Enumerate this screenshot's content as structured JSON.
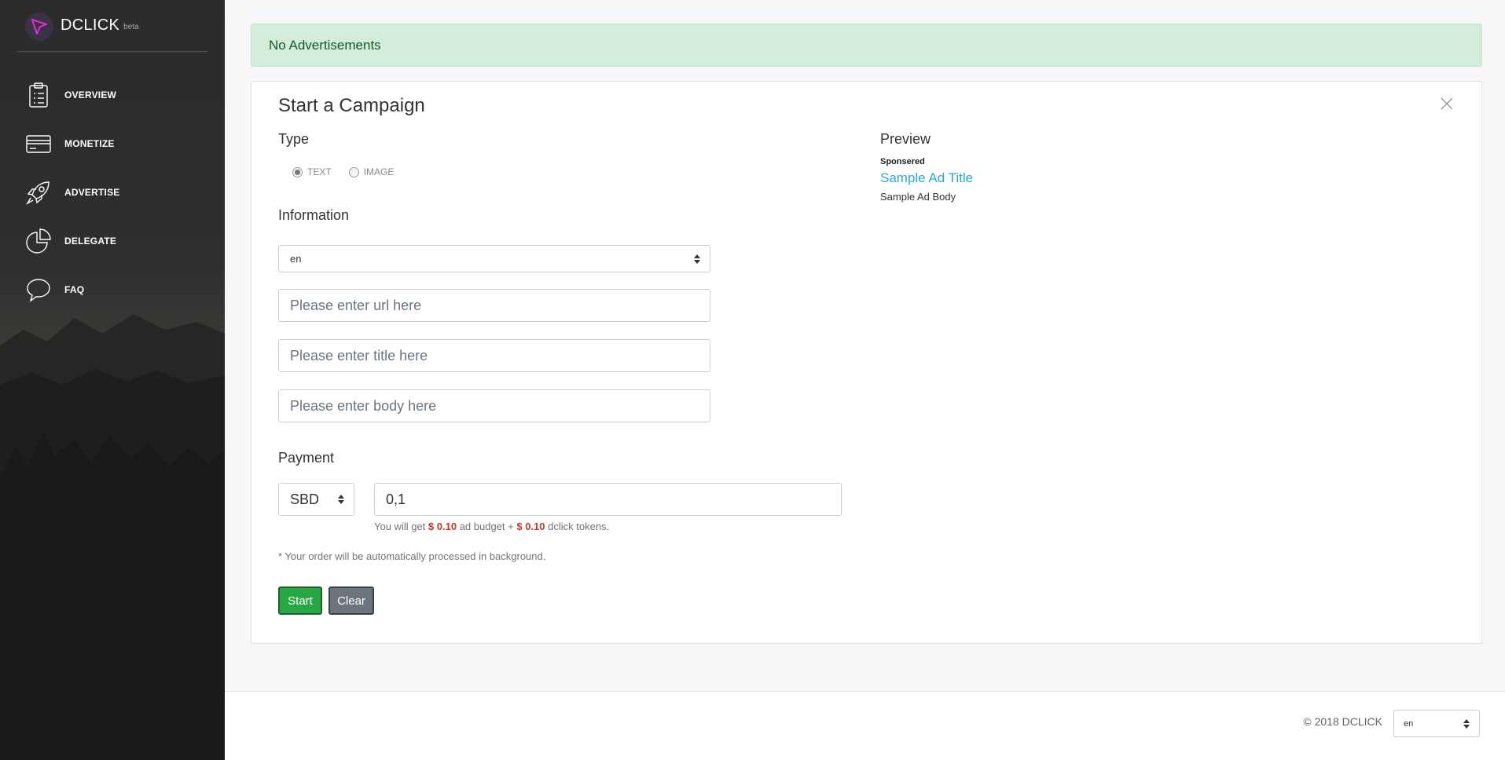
{
  "sidebar": {
    "brand_name": "DCLICK",
    "brand_badge": "beta",
    "items": [
      {
        "label": "OVERVIEW",
        "icon": "clipboard-icon"
      },
      {
        "label": "MONETIZE",
        "icon": "card-icon"
      },
      {
        "label": "ADVERTISE",
        "icon": "rocket-icon"
      },
      {
        "label": "DELEGATE",
        "icon": "pie-chart-icon"
      },
      {
        "label": "FAQ",
        "icon": "chat-bubble-icon"
      }
    ]
  },
  "alert": {
    "text": "No Advertisements"
  },
  "campaign": {
    "title": "Start a Campaign",
    "type_section": "Type",
    "type_options": [
      {
        "label": "TEXT",
        "selected": true
      },
      {
        "label": "IMAGE",
        "selected": false
      }
    ],
    "info_section": "Information",
    "language_value": "en",
    "url_placeholder": "Please enter url here",
    "title_placeholder": "Please enter title here",
    "body_placeholder": "Please enter body here",
    "payment_section": "Payment",
    "currency_value": "SBD",
    "amount_value": "0,1",
    "hint_prefix": "You will get",
    "hint_budget": "$ 0.10",
    "hint_middle": "ad budget +",
    "hint_tokens": "$ 0.10",
    "hint_suffix": "dclick tokens.",
    "note": "* Your order will be automatically processed in background.",
    "start_label": "Start",
    "clear_label": "Clear"
  },
  "preview": {
    "title": "Preview",
    "sponsored": "Sponsered",
    "ad_title": "Sample Ad Title",
    "ad_body": "Sample Ad Body"
  },
  "footer": {
    "copyright": "© 2018 DCLICK",
    "language_value": "en"
  },
  "colors": {
    "accent_logo": "#e52ad6",
    "success": "#28a745",
    "link": "#2aa8d8",
    "money": "#c0392b"
  }
}
